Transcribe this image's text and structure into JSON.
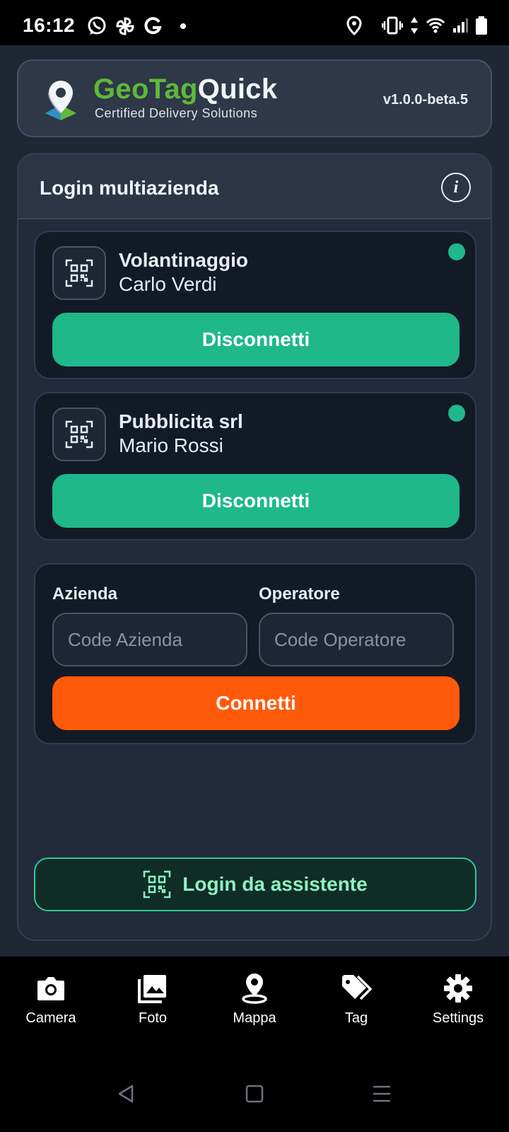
{
  "status_bar": {
    "time": "16:12",
    "left_icons": [
      "whatsapp-icon",
      "pinwheel-icon",
      "google-icon",
      "dot-icon"
    ],
    "right_icons": [
      "location-icon",
      "vibrate-icon",
      "data-arrows-icon",
      "wifi-icon",
      "signal-icon",
      "battery-icon"
    ]
  },
  "header": {
    "brand_part1": "GeoTag",
    "brand_part2": "Quick",
    "subtitle": "Certified Delivery Solutions",
    "version": "v1.0.0-beta.5",
    "colors": {
      "brand_green": "#5fb83a"
    }
  },
  "panel": {
    "title": "Login multiazienda",
    "info_symbol": "i"
  },
  "companies": [
    {
      "company": "Volantinaggio",
      "operator": "Carlo Verdi",
      "status": "connected",
      "button": "Disconnetti"
    },
    {
      "company": "Pubblicita srl",
      "operator": "Mario Rossi",
      "status": "connected",
      "button": "Disconnetti"
    }
  ],
  "connect_form": {
    "azienda_label": "Azienda",
    "azienda_placeholder": "Code Azienda",
    "azienda_value": "",
    "operatore_label": "Operatore",
    "operatore_placeholder": "Code Operatore",
    "operatore_value": "",
    "connect_button": "Connetti"
  },
  "assistant_button": "Login da assistente",
  "bottom_nav": [
    {
      "label": "Camera",
      "icon": "camera-icon"
    },
    {
      "label": "Foto",
      "icon": "photos-icon"
    },
    {
      "label": "Mappa",
      "icon": "map-pin-icon"
    },
    {
      "label": "Tag",
      "icon": "tag-icon"
    },
    {
      "label": "Settings",
      "icon": "gear-icon"
    }
  ],
  "system_nav": [
    "back-icon",
    "home-icon",
    "menu-icon"
  ],
  "colors": {
    "accent_green": "#1eb889",
    "accent_orange": "#ff5a0a",
    "background": "#1f2735"
  }
}
